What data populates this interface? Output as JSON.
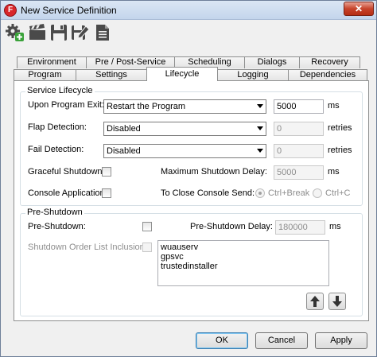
{
  "window": {
    "title": "New Service Definition",
    "close_glyph": "✕",
    "app_icon_letter": "F"
  },
  "toolbar": {
    "buttons": [
      {
        "icon": "gear-add-icon"
      },
      {
        "icon": "clapboard-icon"
      },
      {
        "icon": "save-icon"
      },
      {
        "icon": "save-edit-icon"
      },
      {
        "icon": "document-icon"
      }
    ]
  },
  "tabs": {
    "row1": [
      "Environment",
      "Pre / Post-Service",
      "Scheduling",
      "Dialogs",
      "Recovery"
    ],
    "row2": [
      "Program",
      "Settings",
      "Lifecycle",
      "Logging",
      "Dependencies"
    ],
    "active": "Lifecycle"
  },
  "lifecycle": {
    "group_title": "Service Lifecycle",
    "upon_exit_label": "Upon Program Exit:",
    "upon_exit_value": "Restart the Program",
    "upon_exit_ms": "5000",
    "ms_unit": "ms",
    "flap_label": "Flap Detection:",
    "flap_value": "Disabled",
    "flap_retries": "0",
    "retries_unit": "retries",
    "fail_label": "Fail Detection:",
    "fail_value": "Disabled",
    "fail_retries": "0",
    "graceful_label": "Graceful Shutdown:",
    "max_delay_label": "Maximum Shutdown Delay:",
    "max_delay_value": "5000",
    "console_label": "Console Application:",
    "close_send_label": "To Close Console Send:",
    "radio_ctrl_break": "Ctrl+Break",
    "radio_ctrl_c": "Ctrl+C"
  },
  "preshutdown": {
    "group_title": "Pre-Shutdown",
    "label": "Pre-Shutdown:",
    "delay_label": "Pre-Shutdown Delay:",
    "delay_value": "180000",
    "ms_unit": "ms",
    "order_label": "Shutdown Order List Inclusion:",
    "order_list": [
      "wuauserv",
      "gpsvc",
      "trustedinstaller"
    ]
  },
  "footer": {
    "ok": "OK",
    "cancel": "Cancel",
    "apply": "Apply"
  }
}
